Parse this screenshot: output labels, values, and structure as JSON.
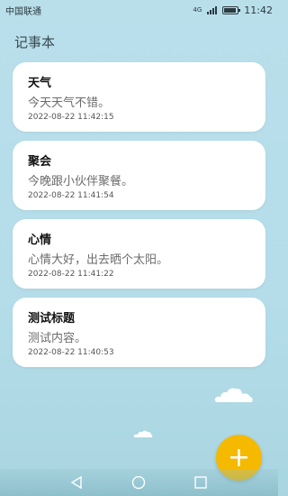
{
  "status": {
    "carrier": "中国联通",
    "network": "4G",
    "time": "11:42"
  },
  "app": {
    "title": "记事本"
  },
  "notes": [
    {
      "title": "天气",
      "content": "今天天气不错。",
      "time": "2022-08-22 11:42:15"
    },
    {
      "title": "聚会",
      "content": "今晚跟小伙伴聚餐。",
      "time": "2022-08-22 11:41:54"
    },
    {
      "title": "心情",
      "content": "心情大好，出去晒个太阳。",
      "time": "2022-08-22 11:41:22"
    },
    {
      "title": "测试标题",
      "content": "测试内容。",
      "time": "2022-08-22 11:40:53"
    }
  ],
  "fab": {
    "icon": "plus-icon",
    "label": "+",
    "color": "#f5b900"
  },
  "colors": {
    "background": "#b9dfeb",
    "card": "#ffffff"
  }
}
